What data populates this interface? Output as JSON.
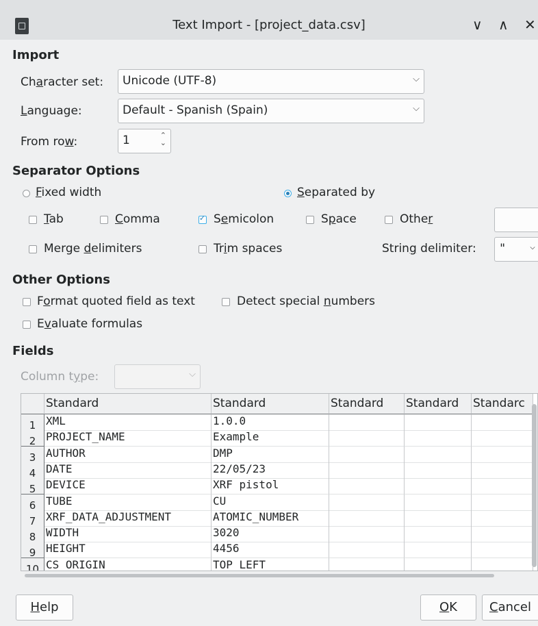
{
  "window": {
    "title": "Text Import - [project_data.csv]"
  },
  "import": {
    "heading": "Import",
    "charset_label": "Character set:",
    "charset_value": "Unicode (UTF-8)",
    "language_label": "Language:",
    "language_value": "Default - Spanish (Spain)",
    "fromrow_label": "From row:",
    "fromrow_value": "1"
  },
  "separator": {
    "heading": "Separator Options",
    "fixed_width": "Fixed width",
    "separated_by": "Separated by",
    "tab": "Tab",
    "comma": "Comma",
    "semicolon": "Semicolon",
    "space": "Space",
    "other": "Other",
    "other_value": "",
    "merge": "Merge delimiters",
    "trim": "Trim spaces",
    "string_delim_label": "String delimiter:",
    "string_delim_value": "\""
  },
  "other_options": {
    "heading": "Other Options",
    "format_quoted": "Format quoted field as text",
    "detect_special": "Detect special numbers",
    "evaluate": "Evaluate formulas"
  },
  "fields": {
    "heading": "Fields",
    "column_type_label": "Column type:",
    "column_type_value": "",
    "headers": [
      "Standard",
      "Standard",
      "Standard",
      "Standard",
      "Standarc"
    ],
    "rows": [
      {
        "n": "1",
        "a": "XML",
        "b": "1.0.0"
      },
      {
        "n": "2",
        "a": "PROJECT_NAME",
        "b": "Example"
      },
      {
        "n": "3",
        "a": "AUTHOR",
        "b": "DMP"
      },
      {
        "n": "4",
        "a": "DATE",
        "b": "22/05/23"
      },
      {
        "n": "5",
        "a": "DEVICE",
        "b": "XRF pistol"
      },
      {
        "n": "6",
        "a": "TUBE",
        "b": "CU"
      },
      {
        "n": "7",
        "a": "XRF_DATA_ADJUSTMENT",
        "b": "ATOMIC_NUMBER"
      },
      {
        "n": "8",
        "a": "WIDTH",
        "b": "3020"
      },
      {
        "n": "9",
        "a": "HEIGHT",
        "b": "4456"
      },
      {
        "n": "10",
        "a": "CS_ORIGIN",
        "b": "TOP_LEFT"
      }
    ]
  },
  "buttons": {
    "help": "Help",
    "ok": "OK",
    "cancel": "Cancel"
  }
}
